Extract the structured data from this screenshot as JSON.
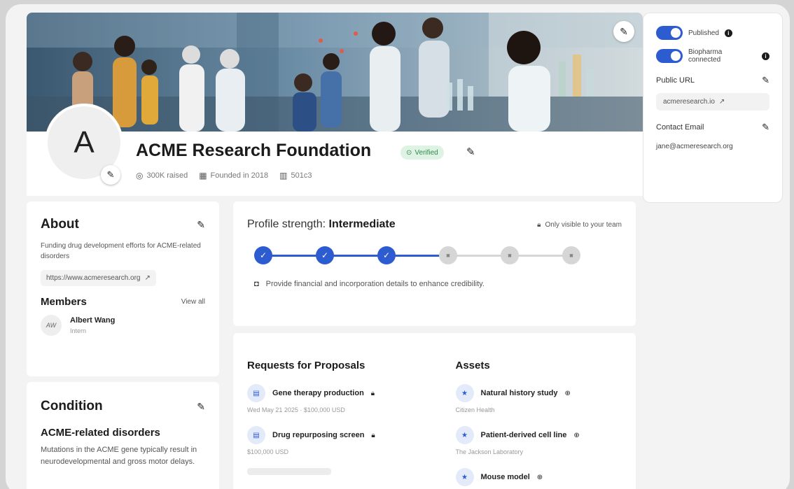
{
  "organization": {
    "name": "ACME Research Foundation",
    "avatar_letter": "A",
    "verified_label": "Verified",
    "meta": {
      "raised": "300K raised",
      "founded": "Founded in 2018",
      "size": "501c3"
    }
  },
  "settings": {
    "published_label": "Published",
    "biopharma_label": "Biopharma connected",
    "public_url_label": "Public URL",
    "public_url_value": "acmeresearch.io",
    "contact_email_label": "Contact Email",
    "contact_email_value": "jane@acmeresearch.org"
  },
  "about": {
    "title": "About",
    "description": "Funding drug development efforts for ACME-related disorders",
    "website": "https://www.acmeresearch.org",
    "members_title": "Members",
    "view_all_label": "View all",
    "members": [
      {
        "initials": "AW",
        "name": "Albert Wang",
        "role": "Intern"
      }
    ]
  },
  "condition": {
    "title": "Condition",
    "name": "ACME-related disorders",
    "description": "Mutations in the ACME gene typically result in neurodevelopmental and gross motor delays."
  },
  "profile_strength": {
    "label": "Profile strength:",
    "level": "Intermediate",
    "visibility": "Only visible to your team",
    "steps_total": 6,
    "steps_done": 3,
    "hint": "Provide financial and incorporation details to enhance credibility."
  },
  "rfps": {
    "title": "Requests for Proposals",
    "items": [
      {
        "title": "Gene therapy production",
        "subtitle": "Wed May 21 2025 · $100,000 USD"
      },
      {
        "title": "Drug repurposing screen",
        "subtitle": "$100,000 USD"
      }
    ]
  },
  "assets": {
    "title": "Assets",
    "items": [
      {
        "title": "Natural history study",
        "subtitle": "Citizen Health"
      },
      {
        "title": "Patient-derived cell line",
        "subtitle": "The Jackson Laboratory"
      },
      {
        "title": "Mouse model",
        "subtitle": ""
      }
    ]
  },
  "colors": {
    "accent": "#2d5bd0",
    "verified_bg": "#dff3e4",
    "verified_text": "#2f8a4b"
  },
  "icons": {
    "edit": "pencil-icon",
    "external": "external-link-icon",
    "lock": "lock-icon",
    "info": "info-icon"
  }
}
